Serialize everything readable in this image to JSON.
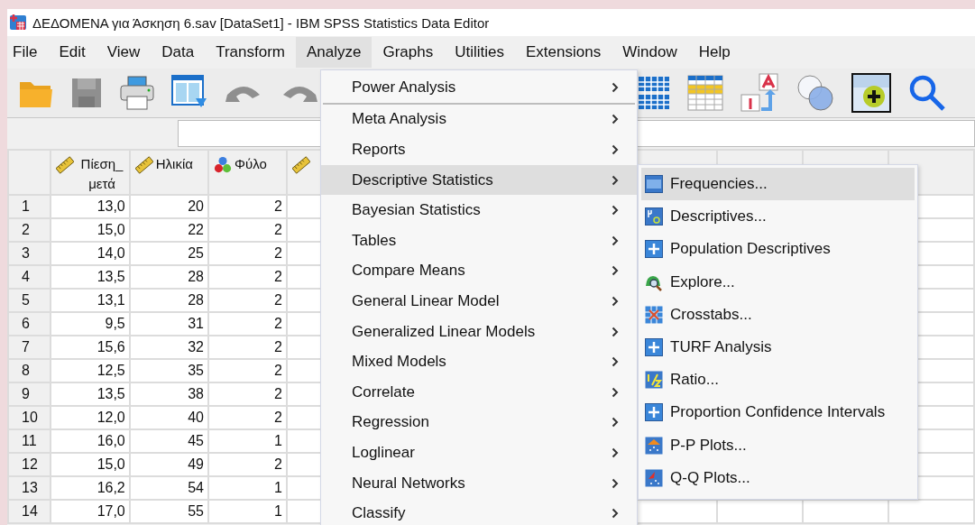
{
  "window": {
    "title": "ΔΕΔΟΜΕΝΑ για Άσκηση 6.sav [DataSet1] - IBM SPSS Statistics Data Editor"
  },
  "menu_bar": [
    {
      "label": "File",
      "selected": false
    },
    {
      "label": "Edit",
      "selected": false
    },
    {
      "label": "View",
      "selected": false
    },
    {
      "label": "Data",
      "selected": false
    },
    {
      "label": "Transform",
      "selected": false
    },
    {
      "label": "Analyze",
      "selected": true
    },
    {
      "label": "Graphs",
      "selected": false
    },
    {
      "label": "Utilities",
      "selected": false
    },
    {
      "label": "Extensions",
      "selected": false
    },
    {
      "label": "Window",
      "selected": false
    },
    {
      "label": "Help",
      "selected": false
    }
  ],
  "grid": {
    "columns": [
      {
        "name": "Πίεση_μετά",
        "kind": "scale"
      },
      {
        "name": "Ηλικία",
        "kind": "scale"
      },
      {
        "name": "Φύλο",
        "kind": "nominal"
      },
      {
        "kind": "scale"
      }
    ],
    "rows": [
      {
        "number": "1",
        "cells": [
          "13,0",
          "20",
          "2"
        ]
      },
      {
        "number": "2",
        "cells": [
          "15,0",
          "22",
          "2"
        ]
      },
      {
        "number": "3",
        "cells": [
          "14,0",
          "25",
          "2"
        ]
      },
      {
        "number": "4",
        "cells": [
          "13,5",
          "28",
          "2"
        ]
      },
      {
        "number": "5",
        "cells": [
          "13,1",
          "28",
          "2"
        ]
      },
      {
        "number": "6",
        "cells": [
          "9,5",
          "31",
          "2"
        ]
      },
      {
        "number": "7",
        "cells": [
          "15,6",
          "32",
          "2"
        ]
      },
      {
        "number": "8",
        "cells": [
          "12,5",
          "35",
          "2"
        ]
      },
      {
        "number": "9",
        "cells": [
          "13,5",
          "38",
          "2"
        ]
      },
      {
        "number": "10",
        "cells": [
          "12,0",
          "40",
          "2"
        ]
      },
      {
        "number": "11",
        "cells": [
          "16,0",
          "45",
          "1"
        ]
      },
      {
        "number": "12",
        "cells": [
          "15,0",
          "49",
          "2"
        ]
      },
      {
        "number": "13",
        "cells": [
          "16,2",
          "54",
          "1"
        ]
      },
      {
        "number": "14",
        "cells": [
          "17,0",
          "55",
          "1"
        ]
      }
    ]
  },
  "analyze_menu": [
    {
      "label": "Power Analysis",
      "submenu": true,
      "selected": false,
      "separator_after": true
    },
    {
      "label": "Meta Analysis",
      "submenu": true,
      "selected": false
    },
    {
      "label": "Reports",
      "submenu": true,
      "selected": false
    },
    {
      "label": "Descriptive Statistics",
      "submenu": true,
      "selected": true
    },
    {
      "label": "Bayesian Statistics",
      "submenu": true,
      "selected": false
    },
    {
      "label": "Tables",
      "submenu": true,
      "selected": false
    },
    {
      "label": "Compare Means",
      "submenu": true,
      "selected": false
    },
    {
      "label": "General Linear Model",
      "submenu": true,
      "selected": false
    },
    {
      "label": "Generalized Linear Models",
      "submenu": true,
      "selected": false
    },
    {
      "label": "Mixed Models",
      "submenu": true,
      "selected": false
    },
    {
      "label": "Correlate",
      "submenu": true,
      "selected": false
    },
    {
      "label": "Regression",
      "submenu": true,
      "selected": false
    },
    {
      "label": "Loglinear",
      "submenu": true,
      "selected": false
    },
    {
      "label": "Neural Networks",
      "submenu": true,
      "selected": false
    },
    {
      "label": "Classify",
      "submenu": true,
      "selected": false
    }
  ],
  "descriptive_submenu": [
    {
      "label": "Frequencies...",
      "selected": true
    },
    {
      "label": "Descriptives...",
      "selected": false
    },
    {
      "label": "Population Descriptives",
      "selected": false
    },
    {
      "label": "Explore...",
      "selected": false
    },
    {
      "label": "Crosstabs...",
      "selected": false
    },
    {
      "label": "TURF Analysis",
      "selected": false
    },
    {
      "label": "Ratio...",
      "selected": false
    },
    {
      "label": "Proportion Confidence Intervals",
      "selected": false
    },
    {
      "label": "P-P Plots...",
      "selected": false
    },
    {
      "label": "Q-Q Plots...",
      "selected": false
    }
  ]
}
